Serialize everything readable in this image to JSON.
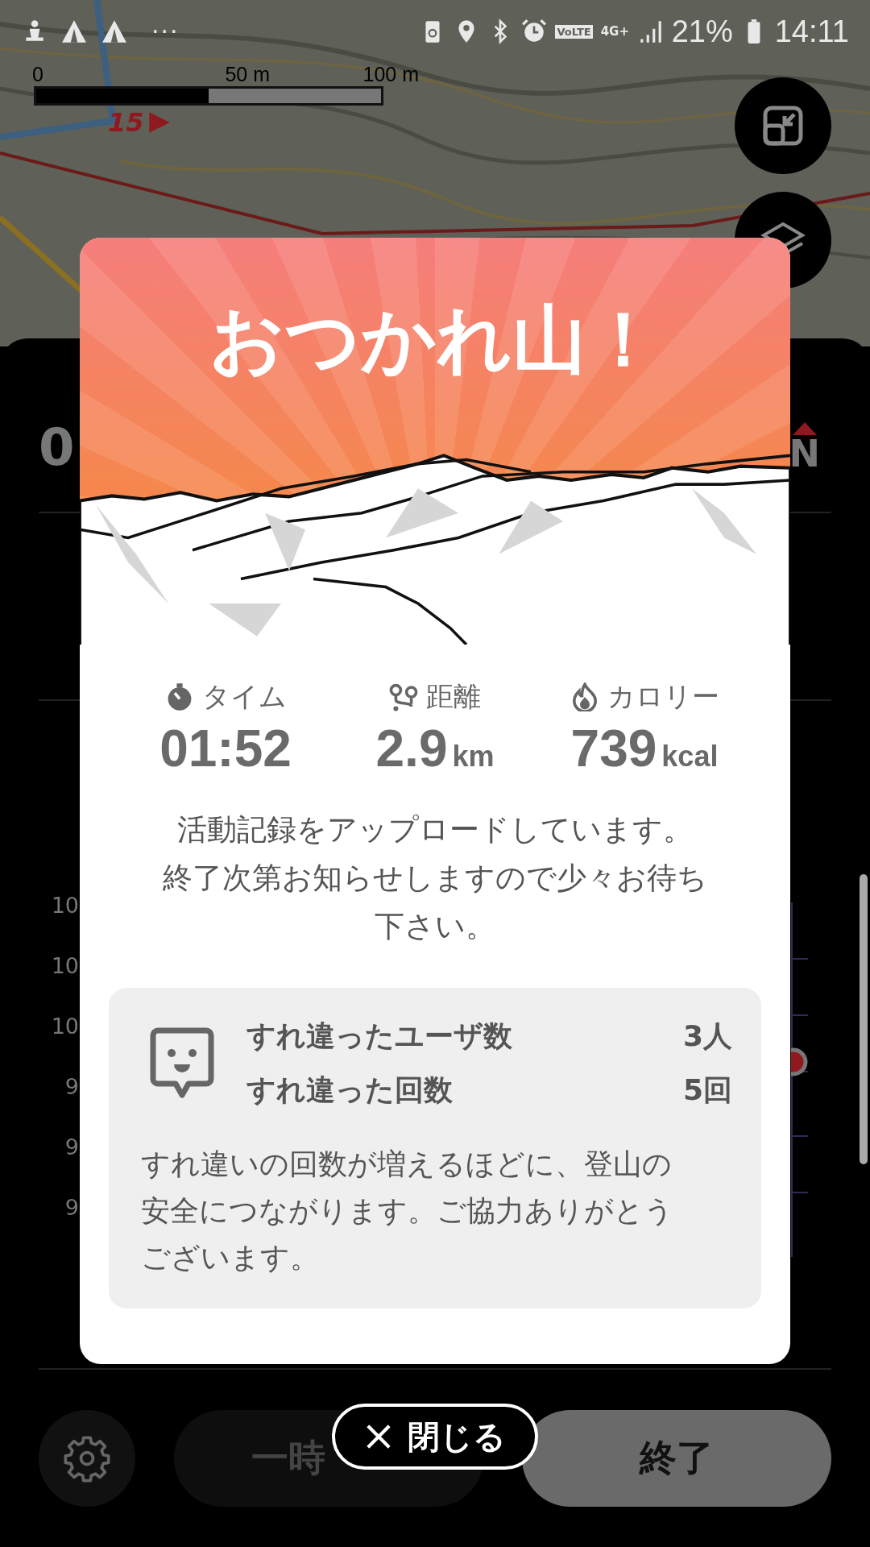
{
  "status_bar": {
    "more": "···",
    "volte": "VoLTE",
    "network": "4G+",
    "battery": "21%",
    "time": "14:11"
  },
  "map": {
    "scale_labels": [
      "0",
      "50 m",
      "100 m"
    ],
    "marker": "15"
  },
  "sheet": {
    "time_partial": "0",
    "compass": "N",
    "axis_labels": [
      "10",
      "10",
      "10",
      "9",
      "9",
      "9"
    ],
    "pause": "一時",
    "finish": "終了"
  },
  "modal": {
    "title": "おつかれ山！",
    "stats": [
      {
        "kind": "time",
        "label": "タイム",
        "value": "01:52"
      },
      {
        "kind": "distance",
        "label": "距離",
        "value": "2.9",
        "unit": "km"
      },
      {
        "kind": "calories",
        "label": "カロリー",
        "value": "739",
        "unit": "kcal"
      }
    ],
    "message": [
      "活動記録をアップロードしています。",
      "終了次第お知らせしますので少々お待ち下さい。"
    ],
    "encounters": {
      "rows": [
        {
          "label": "すれ違ったユーザ数",
          "value": "3人"
        },
        {
          "label": "すれ違った回数",
          "value": "5回"
        }
      ],
      "note": "すれ違いの回数が増えるほどに、登山の安全につながります。ご協力ありがとうございます。"
    },
    "close": "閉じる"
  }
}
